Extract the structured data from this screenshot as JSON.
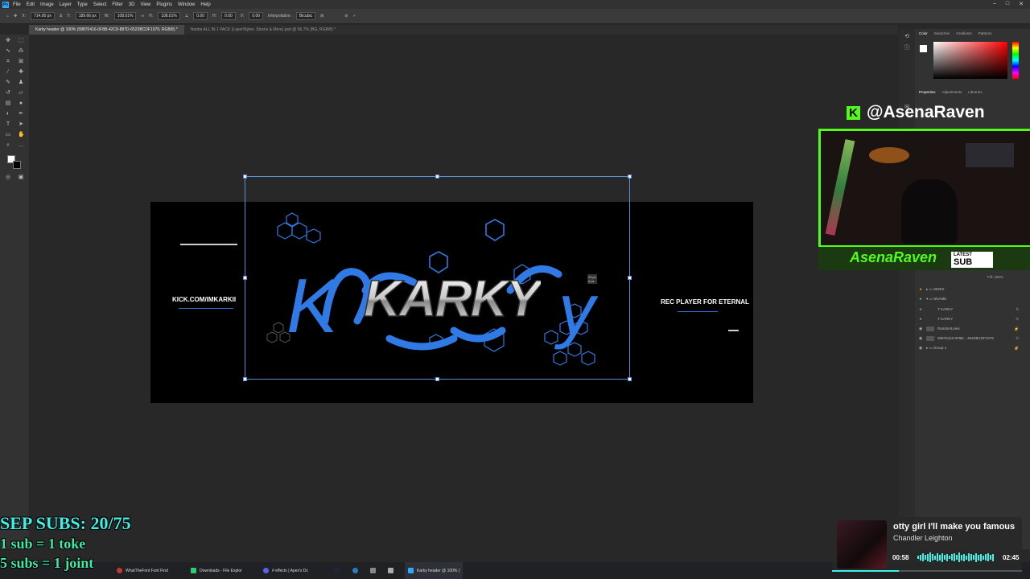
{
  "app": {
    "menu": [
      "File",
      "Edit",
      "Image",
      "Layer",
      "Type",
      "Select",
      "Filter",
      "3D",
      "View",
      "Plugins",
      "Window",
      "Help"
    ],
    "window_controls": [
      "–",
      "□",
      "✕"
    ]
  },
  "options_bar": {
    "x": "714.00 px",
    "y": "189.66 px",
    "w": "108.01%",
    "h": "108.01%",
    "angle": "0.00",
    "h_skew": "0.00",
    "v_skew": "0.00",
    "interpolation_label": "Interpolation:",
    "interpolation_value": "Bicubic"
  },
  "doc_tabs": [
    {
      "label": "Karky header @ 100% (58870416-0F8B-42C8-887D-6523BCDF1079, RGB/8) *",
      "active": true
    },
    {
      "label": "Noobs ALL IN 1 PACK (LayerStyles, Stocks & More).psd @ 66.7% (BG, RGB/8) *",
      "active": false
    }
  ],
  "banner": {
    "left_text": "KICK.COM/IMKARKII",
    "right_text": "REC PLAYER FOR ETERNAL",
    "main_logo": "KARKY",
    "script_text": "Karky"
  },
  "transform_tooltip": {
    "w": "23 px",
    "h": "4 px"
  },
  "right_panel": {
    "color_tabs": [
      "Color",
      "Swatches",
      "Gradients",
      "Patterns"
    ],
    "prop_tabs": [
      "Properties",
      "Adjustments",
      "Libraries"
    ],
    "layers": [
      {
        "name": "SIDES",
        "type": "group"
      },
      {
        "name": "NNAME",
        "type": "group"
      },
      {
        "name": "KARKY",
        "type": "text",
        "fx": true
      },
      {
        "name": "KARKY",
        "type": "text",
        "fx": true
      },
      {
        "name": "RandomLines",
        "type": "image"
      },
      {
        "name": "58870416-0F8B-...6523BCDF1079",
        "type": "image",
        "fx": true
      },
      {
        "name": "Group 1",
        "type": "group"
      }
    ],
    "fill": "Fill: 100%"
  },
  "overlay": {
    "kick_logo": "K",
    "handle": "@AsenaRaven",
    "latest_name": "AsenaRaven",
    "latest_badge_top": "LATEST",
    "latest_badge_bottom": "SUB",
    "subs_goal": "SEP SUBS: 20/75",
    "sub_rule_1": "1 sub = 1 toke",
    "sub_rule_2": "5 subs = 1 joint",
    "music": {
      "song": "otty girl I'll make you famous",
      "artist": "Chandler Leighton",
      "elapsed": "00:58",
      "total": "02:45",
      "progress": 0.35
    }
  },
  "taskbar": {
    "items": [
      "WhatTheFont Font Find",
      "Downloads - File Explor",
      "# effects | Apex's Dc",
      "Karky header @ 100% ("
    ]
  },
  "colors": {
    "kick_green": "#53fc18",
    "cyan": "#3ef0e6",
    "banner_blue": "#2f7ae5"
  }
}
